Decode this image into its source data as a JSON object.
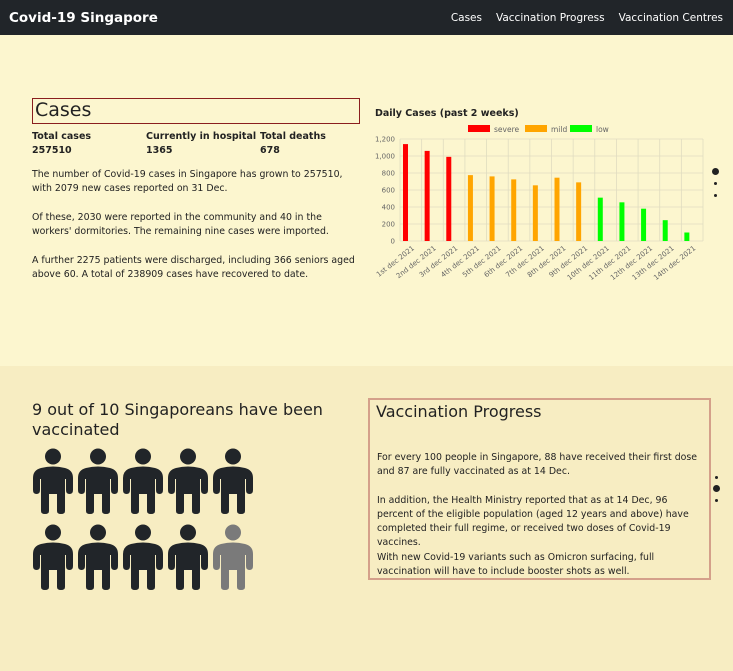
{
  "navbar": {
    "brand": "Covid-19 Singapore",
    "links": [
      "Cases",
      "Vaccination Progress",
      "Vaccination Centres"
    ]
  },
  "cases": {
    "title": "Cases",
    "stats": [
      {
        "label": "Total cases",
        "value": "257510"
      },
      {
        "label": "Currently in hospital",
        "value": "1365"
      },
      {
        "label": "Total deaths",
        "value": "678"
      }
    ],
    "paragraphs": [
      "The number of Covid-19 cases in Singapore has grown to 257510, with 2079 new cases reported on 31 Dec.",
      "Of these, 2030 were reported in the community and 40 in the workers' dormitories. The remaining nine cases were imported.",
      "A further 2275 patients were discharged, including 366 seniors aged above 60. A total of 238909 cases have recovered to date."
    ]
  },
  "chart_title": "Daily Cases (past 2 weeks)",
  "chart_data": {
    "type": "bar",
    "title": "Daily Cases (past 2 weeks)",
    "categories": [
      "1st dec 2021",
      "2nd dec 2021",
      "3rd dec 2021",
      "4th dec 2021",
      "5th dec 2021",
      "6th dec 2021",
      "7th dec 2021",
      "8th dec 2021",
      "9th dec 2021",
      "10th dec 2021",
      "11th dec 2021",
      "12th dec 2021",
      "13th dec 2021",
      "14th dec 2021"
    ],
    "values": [
      1140,
      1060,
      990,
      775,
      760,
      725,
      655,
      745,
      690,
      510,
      455,
      380,
      245,
      100
    ],
    "bar_series": [
      "severe",
      "severe",
      "severe",
      "mild",
      "mild",
      "mild",
      "mild",
      "mild",
      "mild",
      "low",
      "low",
      "low",
      "low",
      "low"
    ],
    "legend": [
      {
        "name": "severe",
        "color": "#ff0000"
      },
      {
        "name": "mild",
        "color": "#ffa500"
      },
      {
        "name": "low",
        "color": "#00ff00"
      }
    ],
    "yticks": [
      "0",
      "200",
      "400",
      "600",
      "800",
      "1,000",
      "1,200"
    ],
    "ylim": [
      0,
      1200
    ],
    "grid": true,
    "legend_position": "top"
  },
  "vaccination": {
    "headline": "9 out of 10 Singaporeans have been vaccinated",
    "vaccinated_count": 9,
    "total_count": 10,
    "person_color": "#212529",
    "unvaccinated_color": "#7a7a7a",
    "title": "Vaccination Progress",
    "paragraphs": [
      "For every 100 people in Singapore, 88 have received their first dose and 87 are fully vaccinated as at 14 Dec.",
      "In addition, the Health Ministry reported that as at 14 Dec, 96 percent of the eligible population (aged 12 years and above) have completed their full regime, or received two doses of Covid-19 vaccines.",
      "With new Covid-19 variants such as Omicron surfacing, full vaccination will have to include booster shots as well."
    ]
  }
}
